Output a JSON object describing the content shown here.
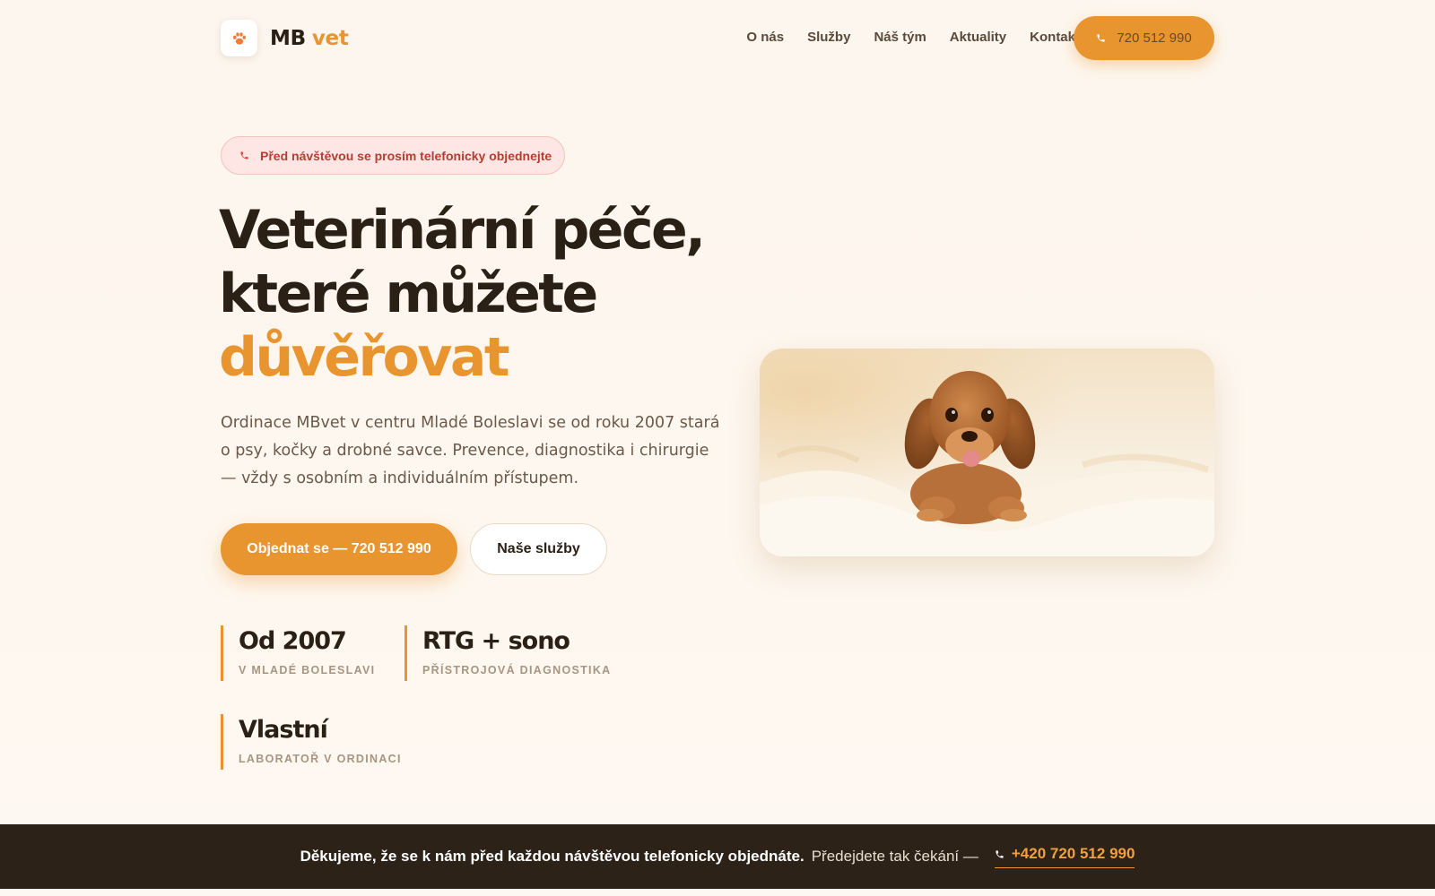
{
  "header": {
    "logo_mb": "MB",
    "logo_vet": "vet",
    "logo_icon": "paw-icon",
    "nav": [
      {
        "label": "O nás"
      },
      {
        "label": "Služby"
      },
      {
        "label": "Náš tým"
      },
      {
        "label": "Aktuality"
      },
      {
        "label": "Kontakt"
      }
    ],
    "phone_label": "720 512 990"
  },
  "hero": {
    "notice": "Před návštěvou se prosím telefonicky objednejte",
    "title_line1": "Veterinární péče,",
    "title_line2": "které můžete",
    "title_accent": "důvěřovat",
    "description": "Ordinace MBvet v centru Mladé Boleslavi se od roku 2007 stará o psy, kočky a drobné savce. Prevence, diagnostika i chirurgie — vždy s osobním a individuálním přístupem.",
    "primary_button": "Objednat se — 720 512 990",
    "secondary_button": "Naše služby",
    "image_icon": "puppy-photo"
  },
  "stats": [
    {
      "value": "Od 2007",
      "label": "V MLADÉ BOLESLAVI"
    },
    {
      "value": "RTG + sono",
      "label": "PŘÍSTROJOVÁ DIAGNOSTIKA"
    },
    {
      "value": "Vlastní",
      "label": "LABORATOŘ V ORDINACI"
    }
  ],
  "bottom_bar": {
    "strong_text": "Děkujeme, že se k nám před každou návštěvou telefonicky objednáte.",
    "normal_text": "Předejdete tak čekání —",
    "phone": "+420 720 512 990"
  },
  "colors": {
    "accent": "#e8952f",
    "dark": "#2a2016",
    "notice_bg": "#fde6e3",
    "notice_text": "#b53d32",
    "bottom_bar_bg": "#2d2218"
  }
}
